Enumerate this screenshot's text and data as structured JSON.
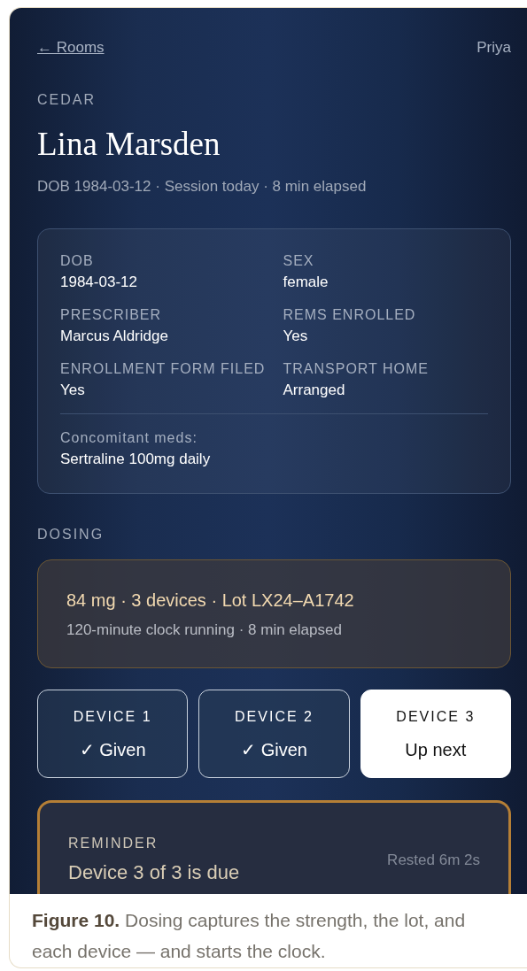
{
  "nav": {
    "back_link": "← Rooms",
    "user": "Priya"
  },
  "room": "CEDAR",
  "patient": {
    "name": "Lina Marsden",
    "summary": "DOB 1984-03-12 · Session today · 8 min elapsed"
  },
  "details": [
    {
      "label": "DOB",
      "value": "1984-03-12"
    },
    {
      "label": "SEX",
      "value": "female"
    },
    {
      "label": "PRESCRIBER",
      "value": "Marcus Aldridge"
    },
    {
      "label": "REMS ENROLLED",
      "value": "Yes"
    },
    {
      "label": "ENROLLMENT FORM FILED",
      "value": "Yes"
    },
    {
      "label": "TRANSPORT HOME",
      "value": "Arranged"
    }
  ],
  "concomitant": {
    "label": "Concomitant meds:",
    "value": "Sertraline 100mg daily"
  },
  "dosing": {
    "heading": "DOSING",
    "summary": "84 mg · 3 devices · Lot LX24–A1742",
    "clock": "120-minute clock running · 8 min elapsed"
  },
  "devices": [
    {
      "label": "DEVICE 1",
      "status": "✓ Given",
      "selected": false
    },
    {
      "label": "DEVICE 2",
      "status": "✓ Given",
      "selected": false
    },
    {
      "label": "DEVICE 3",
      "status": "Up next",
      "selected": true
    }
  ],
  "reminder": {
    "heading": "REMINDER",
    "message": "Device 3 of 3 is due",
    "rested": "Rested 6m 2s"
  },
  "caption": {
    "label": "Figure 10.",
    "text": "Dosing captures the strength, the lot, and each device — and starts the clock."
  }
}
